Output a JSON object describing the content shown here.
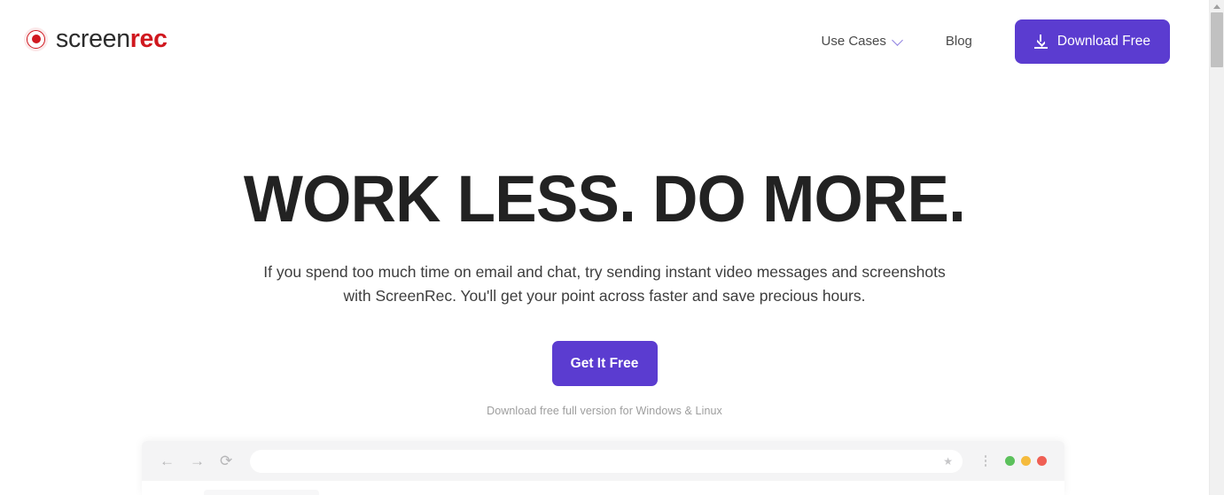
{
  "brand": {
    "logo_icon": "record-circle-icon",
    "name_part_one": "screen",
    "name_part_two": "rec",
    "red": "#d0181f",
    "purple": "#5b3cd0"
  },
  "header": {
    "nav": [
      {
        "label": "Use Cases",
        "has_dropdown": true,
        "icon": "chevron-down-icon"
      },
      {
        "label": "Blog",
        "has_dropdown": false
      }
    ],
    "download_button": {
      "label": "Download Free",
      "icon": "download-icon"
    }
  },
  "hero": {
    "title": "WORK LESS. DO MORE.",
    "subtitle": "If you spend too much time on email and chat, try sending instant video messages and screenshots with ScreenRec. You'll get your point across faster and save precious hours.",
    "cta_label": "Get It Free",
    "cta_note": "Download free full version for Windows & Linux"
  },
  "browser_mock": {
    "back_icon": "arrow-left-icon",
    "forward_icon": "arrow-right-icon",
    "reload_icon": "reload-icon",
    "url_value": "",
    "url_placeholder": "",
    "star_icon": "star-icon",
    "menu_icon": "kebab-menu-icon",
    "window_dots": [
      "#5cc15c",
      "#f5bb3d",
      "#ef5f54"
    ]
  },
  "scrollbar": {
    "up_arrow_icon": "scroll-up-arrow-icon",
    "thumb_label": "vertical-scroll-thumb"
  }
}
